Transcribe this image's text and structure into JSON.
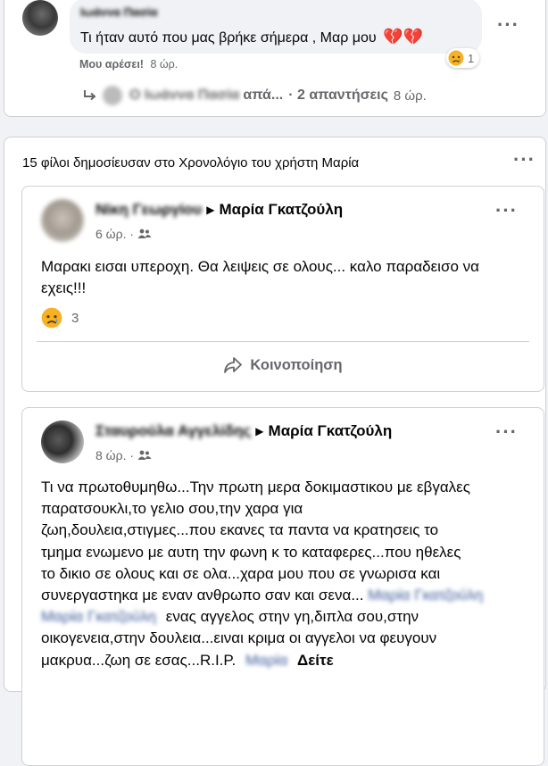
{
  "top_comment": {
    "author": "Ιωάννα Πασία",
    "text": "Τι ήταν αυτό που μας βρήκε σήμερα , Μαρ μου",
    "like_action": "Μου αρέσει!",
    "time": "8 ώρ.",
    "reaction_count": "1",
    "reply_author": "Ο Ιωάννα Πασία",
    "reply_text": "απά...",
    "reply_count": "· 2 απαντήσεις",
    "reply_time": "8 ώρ."
  },
  "group": {
    "header": "15 φίλοι δημοσίευσαν στο Χρονολόγιο του χρήστη Μαρία",
    "posts": [
      {
        "author": "Νίκη Γεωργίου",
        "target": "Μαρία Γκατζούλη",
        "time": "6 ώρ. ·",
        "text": "Μαρακι εισαι υπεροχη. Θα λειψεις σε ολους... καλο παραδεισο να εχεις!!!",
        "reaction_count": "3",
        "share_label": "Κοινοποίηση"
      },
      {
        "author": "Σταυρούλα Αγγελίδης",
        "target": "Μαρία Γκατζούλη",
        "time": "8 ώρ. ·",
        "lines": [
          "Τι να πρωτοθυμηθω...Την πρωτη μερα δοκιμαστικου με εβγαλες",
          "παρατσουκλι,το γελιο σου,την χαρα  για",
          "ζωη,δουλεια,στιγμες...που εκανες τα παντα να κρατησεις το",
          "τμημα ενωμενο με αυτη την φωνη κ το καταφερες...που ηθελες",
          "το δικιο σε ολους και σε ολα...χαρα μου που σε γνωρισα και",
          "συνεργαστηκα με εναν ανθρωπο σαν και σενα...",
          "ενας αγγελος στην γη,διπλα σου,στην",
          "οικογενεια,στην δουλεια...ειναι κριμα οι αγγελοι να φευγουν",
          "μακρυα...ζωη σε εσας...R.I.P."
        ],
        "mention_1": "Μαρία Γκατζούλη",
        "mention_2": "Μαρία Γκατζούλη",
        "mention_3": "Μαρία",
        "see_more": "Δείτε"
      }
    ]
  },
  "icons": {
    "more": "more-horizontal-icon",
    "broken_heart": "broken-heart-emoji",
    "sad": "sad-reaction-icon",
    "share": "share-arrow-icon",
    "audience": "friends-audience-icon",
    "reply_arrow": "reply-arrow-icon"
  },
  "colors": {
    "background": "#f0f2f5",
    "card": "#ffffff",
    "secondary_text": "#65676b",
    "comment_bubble": "#f0f2f5",
    "sad_yellow": "#f7b125",
    "broken_heart_red": "#e41e3f"
  }
}
